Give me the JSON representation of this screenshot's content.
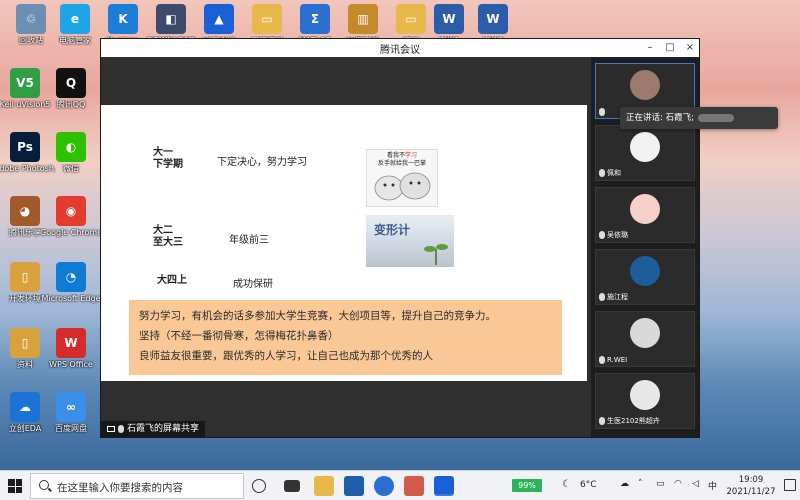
{
  "desktop": {
    "icons": [
      {
        "label": "回收站",
        "color": "#6b8fb3",
        "glyph": "♲",
        "icon": "recycle-bin-icon"
      },
      {
        "label": "电脑管家",
        "color": "#1ea5e8",
        "glyph": "e",
        "icon": "edge-legacy-icon"
      },
      {
        "label": "Kuaikan",
        "color": "#1c7ed6",
        "glyph": "K",
        "icon": "k-app-icon"
      },
      {
        "label": "DOWNLOAD",
        "color": "#3d4a6b",
        "glyph": "◧",
        "icon": "installer-icon"
      },
      {
        "label": "飞书会议",
        "color": "#1a5fd6",
        "glyph": "▲",
        "icon": "meeting-app-icon"
      },
      {
        "label": "学习资料",
        "color": "#e8b84a",
        "glyph": "▭",
        "icon": "folder-icon"
      },
      {
        "label": "MATLAB",
        "color": "#2b6fd0",
        "glyph": "Σ",
        "icon": "math-app-icon"
      },
      {
        "label": "压缩文件",
        "color": "#c48a2a",
        "glyph": "▥",
        "icon": "archive-icon"
      },
      {
        "label": "资料",
        "color": "#e8b84a",
        "glyph": "▭",
        "icon": "folder-icon"
      },
      {
        "label": "文档1",
        "color": "#2a5caa",
        "glyph": "W",
        "icon": "word-doc-icon"
      },
      {
        "label": "文档2",
        "color": "#2a5caa",
        "glyph": "W",
        "icon": "word-doc-icon"
      },
      {
        "label": "Keil uVision5",
        "color": "#2f9e44",
        "glyph": "V5",
        "icon": "keil-icon"
      },
      {
        "label": "腾讯QQ",
        "color": "#111111",
        "glyph": "Q",
        "icon": "qq-icon"
      },
      {
        "label": "Adobe Photosh...",
        "color": "#061e3c",
        "glyph": "Ps",
        "icon": "photoshop-icon"
      },
      {
        "label": "微信",
        "color": "#2dc100",
        "glyph": "◐",
        "icon": "wechat-icon"
      },
      {
        "label": "腾讯乐享",
        "color": "#a05a2c",
        "glyph": "◕",
        "icon": "bear-app-icon"
      },
      {
        "label": "Google Chrome",
        "color": "#e33b2e",
        "glyph": "◉",
        "icon": "chrome-icon"
      },
      {
        "label": "开发环境",
        "color": "#d9a13c",
        "glyph": "▯",
        "icon": "document-icon"
      },
      {
        "label": "Microsoft Edge",
        "color": "#0f7bd2",
        "glyph": "◔",
        "icon": "edge-icon"
      },
      {
        "label": "资料",
        "color": "#d9a13c",
        "glyph": "▯",
        "icon": "document-icon"
      },
      {
        "label": "WPS Office",
        "color": "#d62b2b",
        "glyph": "W",
        "icon": "wps-icon"
      },
      {
        "label": "立创EDA",
        "color": "#1c73d6",
        "glyph": "☁",
        "icon": "lceda-icon"
      },
      {
        "label": "百度网盘",
        "color": "#3b8fe8",
        "glyph": "∞",
        "icon": "baidu-netdisk-icon"
      }
    ]
  },
  "window": {
    "title": "腾讯会议",
    "minimize": "–",
    "maximize": "□",
    "close": "×"
  },
  "slide": {
    "rows": [
      {
        "year": "大一\n下学期",
        "desc": "下定决心，努力学习"
      },
      {
        "year": "大二\n至大三",
        "desc": "年级前三"
      },
      {
        "year": "大四上",
        "desc": "成功保研"
      }
    ],
    "meme_caption_a": "看我不",
    "meme_caption_red": "学习",
    "meme_caption_b": "反手就给我一巴掌",
    "image2_text": "变形计",
    "quote_lines": [
      "努力学习，有机会的话多参加大学生竞赛，大创项目等，提升自己的竞争力。",
      "坚持（不经一番彻骨寒，怎得梅花扑鼻香）",
      "良师益友很重要，跟优秀的人学习，让自己也成为那个优秀的人"
    ]
  },
  "share_label": "石霞飞的屏幕共享",
  "speaking": {
    "label": "正在讲话: 石霞飞;"
  },
  "participants": [
    {
      "name": "",
      "active": true,
      "color": "#9b7b6b"
    },
    {
      "name": "佩和",
      "active": false,
      "color": "#f2f2f2"
    },
    {
      "name": "吴依璐",
      "active": false,
      "color": "#f4d0c8"
    },
    {
      "name": "施江程",
      "active": false,
      "color": "#1b5e9a"
    },
    {
      "name": "R.WEI",
      "active": false,
      "color": "#d9d9d9"
    },
    {
      "name": "生医2102熊超卉",
      "active": false,
      "color": "#e8e8e8"
    }
  ],
  "taskbar": {
    "search_placeholder": "在这里输入你要搜索的内容",
    "battery": "99%",
    "temperature": "6°C",
    "ime": "中",
    "time": "19:09",
    "date": "2021/11/27"
  }
}
